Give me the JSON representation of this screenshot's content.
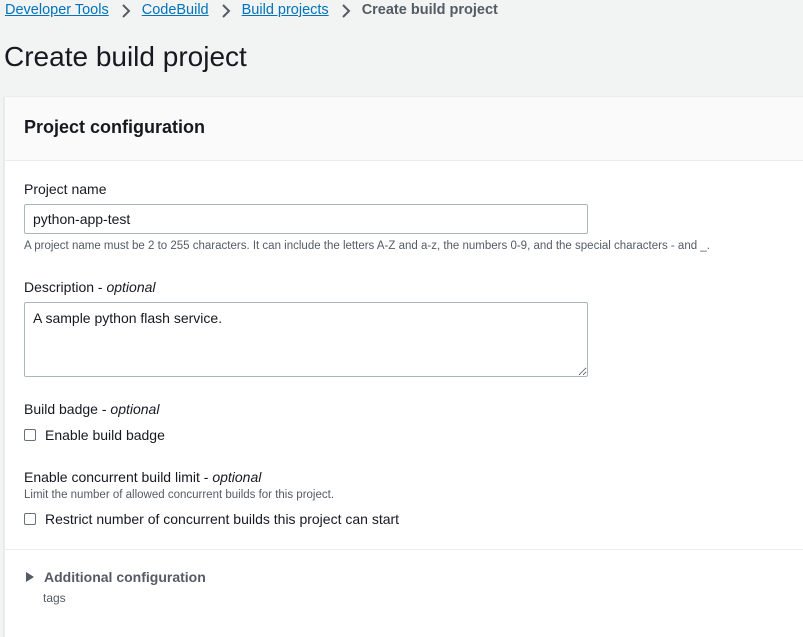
{
  "breadcrumb": {
    "items": [
      "Developer Tools",
      "CodeBuild",
      "Build projects"
    ],
    "current": "Create build project"
  },
  "page": {
    "title": "Create build project"
  },
  "project_config": {
    "title": "Project configuration",
    "project_name": {
      "label": "Project name",
      "value": "python-app-test",
      "hint": "A project name must be 2 to 255 characters. It can include the letters A-Z and a-z, the numbers 0-9, and the special characters - and _."
    },
    "description": {
      "label": "Description - ",
      "optional": "optional",
      "value": "A sample python flash service."
    },
    "build_badge": {
      "label": "Build badge - ",
      "optional": "optional",
      "checkbox_label": "Enable build badge",
      "checked": false
    },
    "concurrent_limit": {
      "label": "Enable concurrent build limit - ",
      "optional": "optional",
      "hint": "Limit the number of allowed concurrent builds for this project.",
      "checkbox_label": "Restrict number of concurrent builds this project can start",
      "checked": false
    },
    "additional": {
      "label": "Additional configuration",
      "sub": "tags"
    }
  },
  "colors": {
    "link": "#0073bb",
    "background": "#f2f3f3",
    "panel": "#ffffff",
    "text": "#16191f",
    "muted": "#545b64"
  }
}
